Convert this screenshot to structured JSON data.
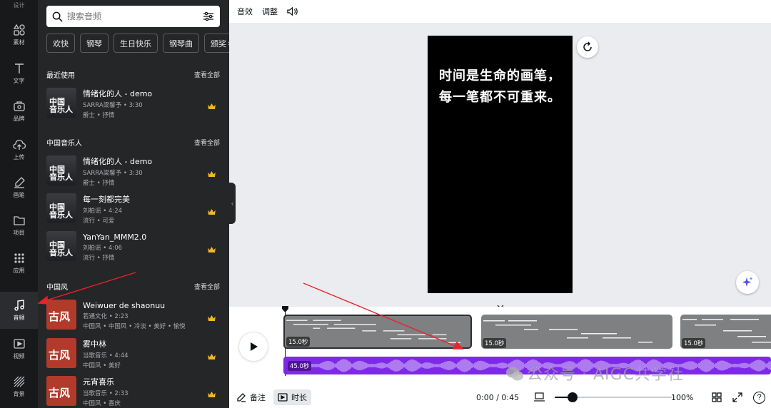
{
  "rail": {
    "top_label": "设计",
    "items": [
      {
        "label": "素材",
        "icon": "elements-icon"
      },
      {
        "label": "文字",
        "icon": "text-icon"
      },
      {
        "label": "品牌",
        "icon": "brand-icon"
      },
      {
        "label": "上传",
        "icon": "upload-icon"
      },
      {
        "label": "画笔",
        "icon": "draw-icon"
      },
      {
        "label": "项目",
        "icon": "folder-icon"
      },
      {
        "label": "应用",
        "icon": "apps-icon"
      },
      {
        "label": "音频",
        "icon": "music-icon"
      },
      {
        "label": "视频",
        "icon": "video-icon"
      },
      {
        "label": "背景",
        "icon": "background-icon"
      }
    ]
  },
  "panel": {
    "search_placeholder": "搜索音频",
    "chips": [
      "欢快",
      "钢琴",
      "生日快乐",
      "钢琴曲",
      "颁奖"
    ],
    "sections": [
      {
        "title": "最近使用",
        "see_all": "查看全部"
      },
      {
        "title": "中国音乐人",
        "see_all": "查看全部"
      },
      {
        "title": "中国风",
        "see_all": "查看全部"
      }
    ],
    "recent": [
      {
        "title": "情绪化的人 - demo",
        "artist": "SARRA梁馨予 • 3:30",
        "tags": "爵士 • 抒情"
      }
    ],
    "chinese_artists": [
      {
        "title": "情绪化的人 - demo",
        "artist": "SARRA梁馨予 • 3:30",
        "tags": "爵士 • 抒情"
      },
      {
        "title": "每一刻都完美",
        "artist": "刘柏谣 • 4:24",
        "tags": "流行 • 可爱"
      },
      {
        "title": "YanYan_MMM2.0",
        "artist": "刘柏谣 • 4:06",
        "tags": "流行 • 抒情"
      }
    ],
    "chinese_style": [
      {
        "title": "Weiwuer de shaonuu",
        "artist": "若通文化 • 2:23",
        "tags": "中国风 • 中国风 • 冷淡 • 美好 • 愉悦"
      },
      {
        "title": "雾中林",
        "artist": "当歌音乐 • 4:44",
        "tags": "中国风 • 美好"
      },
      {
        "title": "元宵喜乐",
        "artist": "当歌音乐 • 2:33",
        "tags": "中国风 • 喜庆"
      }
    ],
    "thumb_cn_text": "中国\n音乐人",
    "thumb_gf_text": "古风"
  },
  "topbar": {
    "effects": "音效",
    "adjust": "调整"
  },
  "canvas": {
    "line1": "时间是生命的画笔，",
    "line2": "每一笔都不可重来。"
  },
  "timeline": {
    "clips": [
      {
        "duration": "15.0秒"
      },
      {
        "duration": "15.0秒"
      },
      {
        "duration": "15.0秒"
      }
    ],
    "audio_duration": "45.0秒",
    "notes": "备注",
    "duration_btn": "时长",
    "time": "0:00 / 0:45",
    "zoom": "100%",
    "zoom_fraction": 0.15,
    "help": "?"
  },
  "watermark": "公众号 · AIGC共学社",
  "colors": {
    "accent": "#7d2ae8",
    "rail_bg": "#18191b",
    "panel_bg": "#252627",
    "arrow": "#e8232a",
    "crown": "#f3b62b"
  }
}
